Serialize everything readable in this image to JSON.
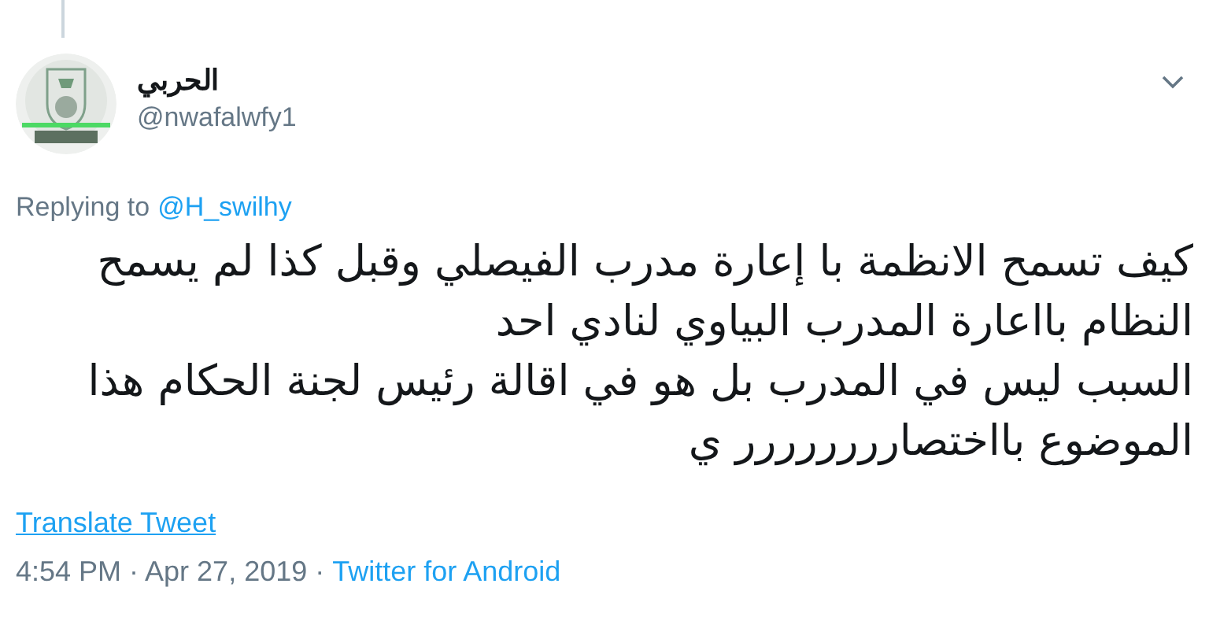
{
  "author": {
    "name": "الحربي",
    "handle": "@nwafalwfy1"
  },
  "reply": {
    "label": "Replying to",
    "to": "@H_swilhy"
  },
  "tweet": {
    "paragraphs": [
      "كيف تسمح الانظمة با إعارة مدرب الفيصلي وقبل كذا لم يسمح النظام بااعارة المدرب البياوي لنادي احد",
      "السبب ليس في المدرب بل هو في اقالة رئيس لجنة الحكام هذا الموضوع بااختصارررررررر ي"
    ]
  },
  "translate": "Translate Tweet",
  "meta": {
    "time": "4:54 PM · Apr 27, 2019 · ",
    "source": "Twitter for Android"
  }
}
